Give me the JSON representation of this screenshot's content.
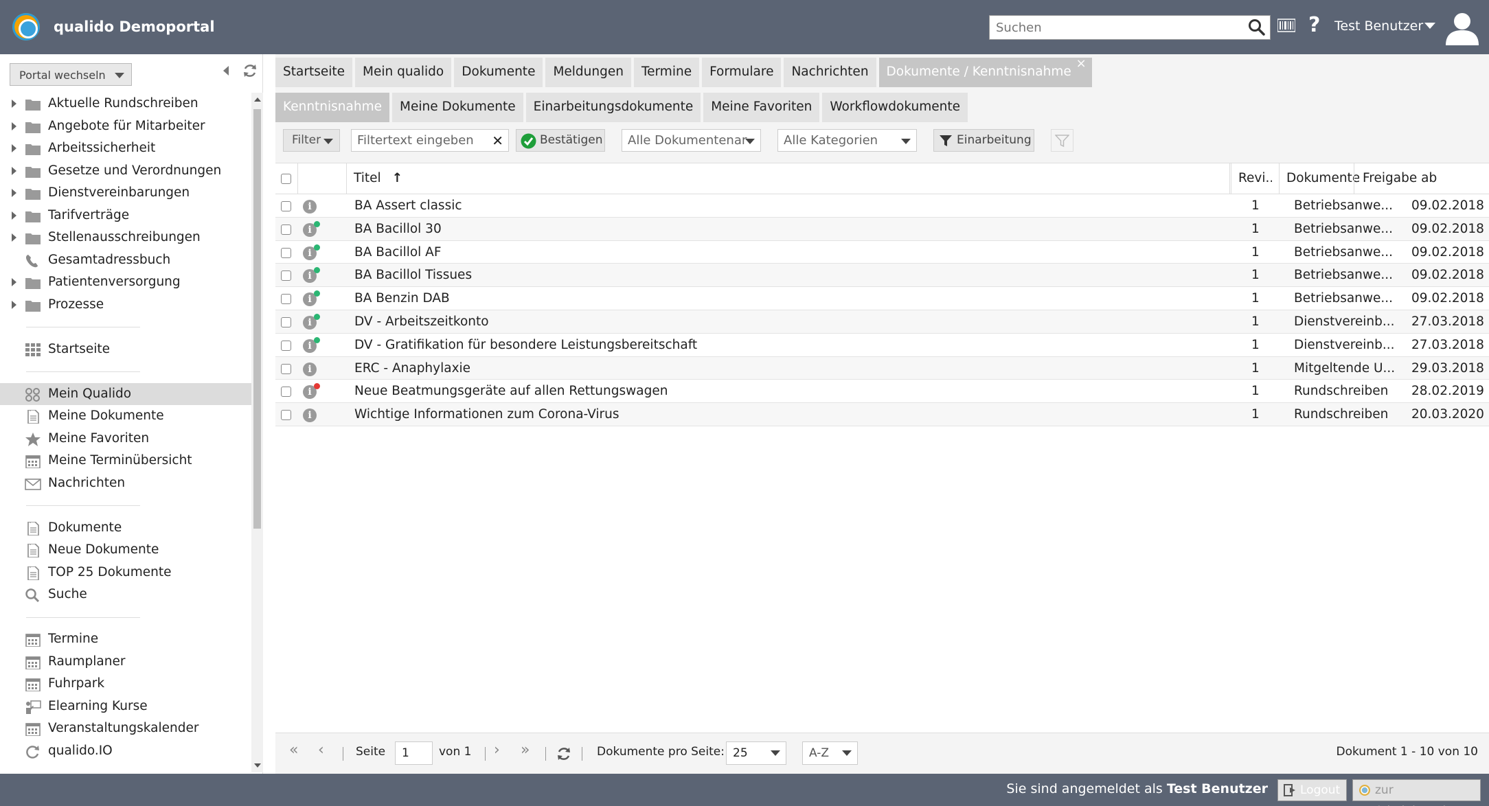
{
  "header": {
    "app_title": "qualido Demoportal",
    "search_placeholder": "Suchen",
    "user_name": "Test Benutzer",
    "help_label": "?"
  },
  "sidebar": {
    "portal_switch_label": "Portal wechseln",
    "tree": [
      {
        "label": "Aktuelle Rundschreiben",
        "icon": "folder-icon"
      },
      {
        "label": "Angebote für Mitarbeiter",
        "icon": "folder-icon"
      },
      {
        "label": "Arbeitssicherheit",
        "icon": "folder-icon"
      },
      {
        "label": "Gesetze und Verordnungen",
        "icon": "folder-icon"
      },
      {
        "label": "Dienstvereinbarungen",
        "icon": "folder-icon"
      },
      {
        "label": "Tarifverträge",
        "icon": "folder-icon"
      },
      {
        "label": "Stellenausschreibungen",
        "icon": "folder-icon"
      },
      {
        "label": "Gesamtadressbuch",
        "icon": "phone-icon"
      },
      {
        "label": "Patientenversorgung",
        "icon": "folder-icon"
      },
      {
        "label": "Prozesse",
        "icon": "folder-icon"
      }
    ],
    "group1": [
      {
        "label": "Startseite",
        "icon": "grid-icon"
      }
    ],
    "group2": [
      {
        "label": "Mein Qualido",
        "icon": "my-qualido-icon"
      },
      {
        "label": "Meine Dokumente",
        "icon": "document-icon"
      },
      {
        "label": "Meine Favoriten",
        "icon": "star-icon"
      },
      {
        "label": "Meine Terminübersicht",
        "icon": "calendar-icon"
      },
      {
        "label": "Nachrichten",
        "icon": "envelope-icon"
      }
    ],
    "group3": [
      {
        "label": "Dokumente",
        "icon": "document-icon"
      },
      {
        "label": "Neue Dokumente",
        "icon": "document-icon"
      },
      {
        "label": "TOP 25 Dokumente",
        "icon": "document-icon"
      },
      {
        "label": "Suche",
        "icon": "search-icon"
      }
    ],
    "group4": [
      {
        "label": "Termine",
        "icon": "calendar-icon"
      },
      {
        "label": "Raumplaner",
        "icon": "calendar-icon"
      },
      {
        "label": "Fuhrpark",
        "icon": "calendar-icon"
      },
      {
        "label": "Elearning Kurse",
        "icon": "presenter-icon"
      },
      {
        "label": "Veranstaltungskalender",
        "icon": "calendar-icon"
      },
      {
        "label": "qualido.IO",
        "icon": "cycle-icon"
      }
    ]
  },
  "main_tabs": [
    "Startseite",
    "Mein qualido",
    "Dokumente",
    "Meldungen",
    "Termine",
    "Formulare",
    "Nachrichten"
  ],
  "active_tab": "Dokumente / Kenntnisnahme",
  "close_label": "×",
  "sub_tabs": [
    "Kenntnisnahme",
    "Meine Dokumente",
    "Einarbeitungsdokumente",
    "Meine Favoriten",
    "Workflowdokumente"
  ],
  "filterbar": {
    "filter_label": "Filter",
    "filter_placeholder": "Filtertext eingeben",
    "clear_label": "✕",
    "confirm_label": "Bestätigen",
    "doc_type_select": "Alle Dokumentenarten",
    "category_select": "Alle Kategorien",
    "einarbeitung_label": "Einarbeitung"
  },
  "grid": {
    "columns": {
      "title": "Titel",
      "revision": "Revi...",
      "doctype": "Dokumenten...",
      "release": "Freigabe ab"
    },
    "sort_indicator": "↑",
    "rows": [
      {
        "title": "BA Assert classic",
        "revision": "1",
        "doctype": "Betriebsanwe...",
        "release": "09.02.2018",
        "badge": ""
      },
      {
        "title": "BA Bacillol 30",
        "revision": "1",
        "doctype": "Betriebsanwe...",
        "release": "09.02.2018",
        "badge": "#2bb673"
      },
      {
        "title": "BA Bacillol AF",
        "revision": "1",
        "doctype": "Betriebsanwe...",
        "release": "09.02.2018",
        "badge": "#2bb673"
      },
      {
        "title": "BA Bacillol Tissues",
        "revision": "1",
        "doctype": "Betriebsanwe...",
        "release": "09.02.2018",
        "badge": "#2bb673"
      },
      {
        "title": "BA Benzin DAB",
        "revision": "1",
        "doctype": "Betriebsanwe...",
        "release": "09.02.2018",
        "badge": "#2bb673"
      },
      {
        "title": "DV - Arbeitszeitkonto",
        "revision": "1",
        "doctype": "Dienstvereinb...",
        "release": "27.03.2018",
        "badge": "#2bb673"
      },
      {
        "title": "DV - Gratifikation für besondere Leistungsbereitschaft",
        "revision": "1",
        "doctype": "Dienstvereinb...",
        "release": "27.03.2018",
        "badge": "#2bb673"
      },
      {
        "title": "ERC - Anaphylaxie",
        "revision": "1",
        "doctype": "Mitgeltende U...",
        "release": "29.03.2018",
        "badge": ""
      },
      {
        "title": "Neue Beatmungsgeräte auf allen Rettungswagen",
        "revision": "1",
        "doctype": "Rundschreiben",
        "release": "28.02.2019",
        "badge": "#e53935"
      },
      {
        "title": "Wichtige Informationen zum Corona-Virus",
        "revision": "1",
        "doctype": "Rundschreiben",
        "release": "20.03.2020",
        "badge": ""
      }
    ]
  },
  "pager": {
    "page_label": "Seite",
    "page_value": "1",
    "of_label": "von 1",
    "per_page_label": "Dokumente pro Seite:",
    "per_page_value": "25",
    "sort_value": "A-Z",
    "summary": "Dokument 1 - 10 von 10"
  },
  "footer": {
    "logged_in_text": "Sie sind angemeldet als",
    "logged_in_user": "Test Benutzer",
    "logout_label": "Logout",
    "admin_label": "zur Administration"
  },
  "colors": {
    "header_bg": "#5b6474",
    "new_badge": "#2bb673",
    "alert_badge": "#e53935"
  }
}
